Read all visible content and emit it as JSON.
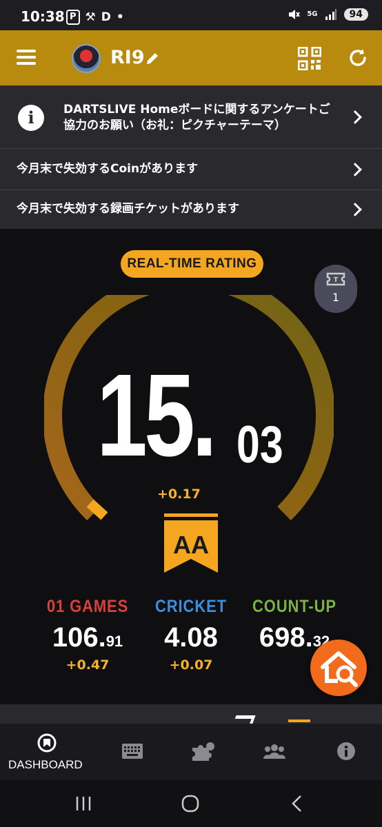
{
  "status_bar": {
    "time": "10:38",
    "left_glyphs": [
      "P",
      "D",
      "•"
    ],
    "network": "5G",
    "battery": "94"
  },
  "header": {
    "user_name": "RI9",
    "brand_color": "#b88a0e"
  },
  "notices": [
    {
      "text": "DARTSLIVE Homeボードに関するアンケートご協力のお願い（お礼：ピクチャーテーマ）",
      "icon": "info-icon"
    },
    {
      "text": "今月末で失効するCoinがあります"
    },
    {
      "text": "今月末で失効する録画チケットがあります"
    }
  ],
  "rating": {
    "pill_label": "REAL-TIME RATING",
    "integer": "15.",
    "decimal": "03",
    "delta": "+0.17",
    "grade": "AA",
    "accent_color": "#f4a621"
  },
  "ticket": {
    "count": "1"
  },
  "stats": [
    {
      "label": "01 GAMES",
      "int": "106.",
      "dec": "91",
      "delta": "+0.47",
      "color": "#d9413a"
    },
    {
      "label": "CRICKET",
      "int": "4.08",
      "dec": "",
      "delta": "+0.07",
      "color": "#3b8fe0"
    },
    {
      "label": "COUNT-UP",
      "int": "698.",
      "dec": "32",
      "delta": "",
      "color": "#7ab342"
    }
  ],
  "bottom_nav": {
    "dashboard_label": "DASHBOARD",
    "items": [
      "dashboard-icon",
      "keyboard-icon",
      "puzzle-icon",
      "people-icon",
      "info-icon"
    ]
  }
}
